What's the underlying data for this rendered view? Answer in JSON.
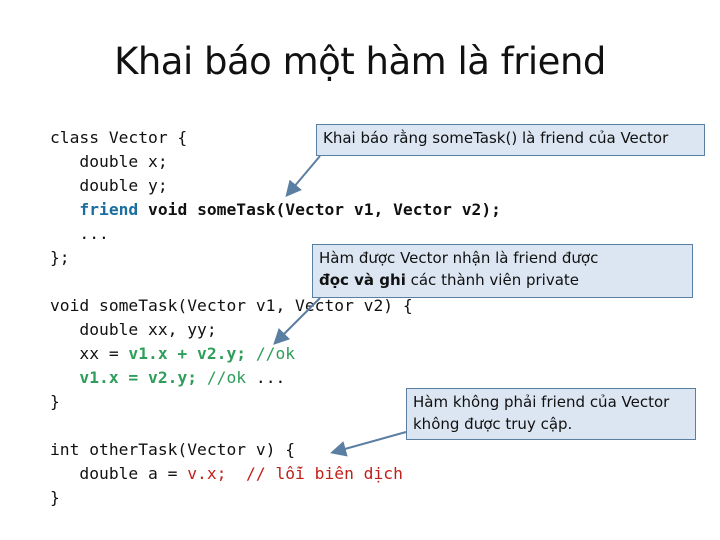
{
  "title": "Khai báo một hàm là friend",
  "code_block_1": {
    "line1": "class Vector {",
    "line2": "   double x;",
    "line3": "   double y;",
    "line4_kw": "friend",
    "line4_rest": " void someTask(Vector v1, Vector v2);",
    "line5": "   ...",
    "line6": "};"
  },
  "code_block_2": {
    "line1": "void someTask(Vector v1, Vector v2) {",
    "line2": "   double xx, yy;",
    "line3_a": "   xx = ",
    "line3_b": "v1.x + v2.y;",
    "line3_c": " //ok",
    "line4_a": "v1.x = v2.y;",
    "line4_b": " //ok ",
    "line4_c": "...",
    "line5": "}"
  },
  "code_block_3": {
    "line1": "int otherTask(Vector v) {",
    "line2_a": "   double a = ",
    "line2_b": "v.x;  // lỗi biên dịch",
    "line3": "}"
  },
  "callouts": {
    "friend_decl": "Khai báo rằng someTask() là friend của Vector",
    "friend_access_1": "Hàm được Vector nhận là friend được",
    "friend_access_2_bold": "đọc và ghi",
    "friend_access_2_rest": " các thành viên private",
    "non_friend_1": "Hàm không phải friend của Vector",
    "non_friend_2": "không được truy cập."
  },
  "colors": {
    "keyword": "#1a6ea0",
    "ok_access": "#2e9e5a",
    "error": "#c0201a",
    "callout_fill": "#dce6f2",
    "callout_border": "#5b7ea3"
  }
}
